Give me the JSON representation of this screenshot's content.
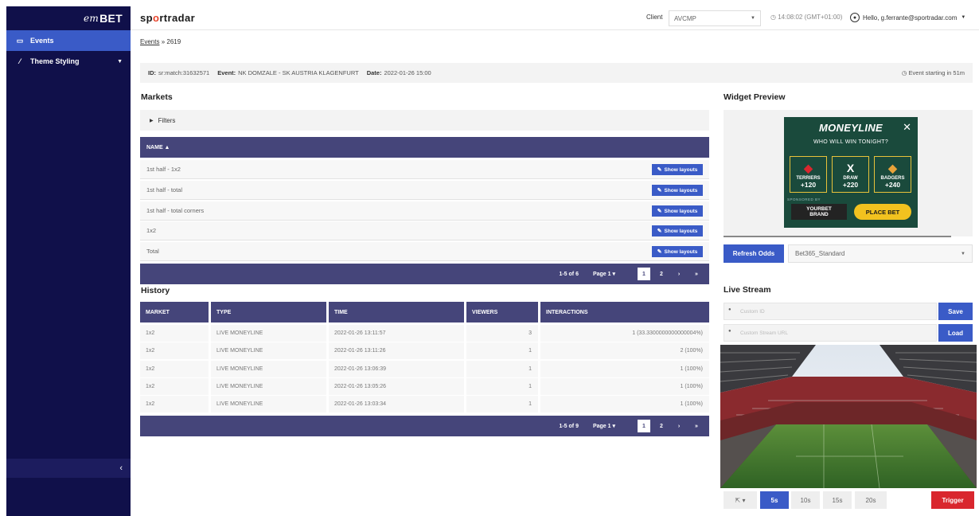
{
  "sidebar": {
    "brand_prefix": "em",
    "brand_suffix": "BET",
    "items": [
      {
        "label": "Events"
      },
      {
        "label": "Theme Styling"
      }
    ],
    "collapse_glyph": "‹"
  },
  "topbar": {
    "logo_pre": "sp",
    "logo_o": "o",
    "logo_post": "rtradar",
    "client_label": "Client",
    "client_value": "AVCMP",
    "time": "14:08:02 (GMT+01:00)",
    "greeting": "Hello, g.ferrante@sportradar.com"
  },
  "breadcrumb": {
    "link": "Events",
    "separator": "»",
    "current": "2619"
  },
  "event": {
    "id_label": "ID:",
    "id_value": "sr:match:31632571",
    "event_label": "Event:",
    "event_value": "NK DOMZALE - SK AUSTRIA KLAGENFURT",
    "date_label": "Date:",
    "date_value": "2022-01-26 15:00",
    "starting": "Event starting in 51m"
  },
  "markets": {
    "title": "Markets",
    "filters_label": "Filters",
    "column_name": "NAME ▲",
    "button_label": "Show layouts",
    "rows": [
      {
        "name": "1st half - 1x2"
      },
      {
        "name": "1st half - total"
      },
      {
        "name": "1st half - total corners"
      },
      {
        "name": "1x2"
      },
      {
        "name": "Total"
      }
    ],
    "pager": {
      "count": "1-5 of 6",
      "page": "Page 1 ▾",
      "pages": [
        "1",
        "2"
      ],
      "next": "›",
      "last": "»"
    }
  },
  "history": {
    "title": "History",
    "columns": [
      "MARKET",
      "TYPE",
      "TIME",
      "VIEWERS",
      "INTERACTIONS"
    ],
    "rows": [
      {
        "market": "1x2",
        "type": "LIVE MONEYLINE",
        "time": "2022-01-26 13:11:57",
        "viewers": "3",
        "interactions": "1 (33.3300000000000004%)"
      },
      {
        "market": "1x2",
        "type": "LIVE MONEYLINE",
        "time": "2022-01-26 13:11:26",
        "viewers": "1",
        "interactions": "2 (100%)"
      },
      {
        "market": "1x2",
        "type": "LIVE MONEYLINE",
        "time": "2022-01-26 13:06:39",
        "viewers": "1",
        "interactions": "1 (100%)"
      },
      {
        "market": "1x2",
        "type": "LIVE MONEYLINE",
        "time": "2022-01-26 13:05:26",
        "viewers": "1",
        "interactions": "1 (100%)"
      },
      {
        "market": "1x2",
        "type": "LIVE MONEYLINE",
        "time": "2022-01-26 13:03:34",
        "viewers": "1",
        "interactions": "1 (100%)"
      }
    ],
    "pager": {
      "count": "1-5 of 9",
      "page": "Page 1 ▾",
      "pages": [
        "1",
        "2"
      ],
      "next": "›",
      "last": "»"
    }
  },
  "widget_preview": {
    "title": "Widget Preview",
    "widget": {
      "title": "MONEYLINE",
      "close": "✕",
      "subtitle": "WHO WILL WIN TONIGHT?",
      "options": [
        {
          "name": "TERRIERS",
          "odds": "+120",
          "icon": "terrier-shield-icon",
          "glyph": "◆",
          "color": "#d9272e"
        },
        {
          "name": "DRAW",
          "odds": "+220",
          "icon": "draw-x-icon",
          "glyph": "X",
          "color": "#ffffff"
        },
        {
          "name": "BADGERS",
          "odds": "+240",
          "icon": "badger-shield-icon",
          "glyph": "◆",
          "color": "#e8a33a"
        }
      ],
      "sponsored": "SPONSORED BY",
      "brand_line1": "YOURBET",
      "brand_line2": "BRAND",
      "place_bet": "PLACE BET"
    },
    "refresh_label": "Refresh Odds",
    "odds_provider": "Bet365_Standard"
  },
  "live_stream": {
    "title": "Live Stream",
    "id_placeholder": "Custom ID",
    "url_placeholder": "Custom Stream URL",
    "save_label": "Save",
    "load_label": "Load",
    "controls": {
      "position": "⇱ ▾",
      "intervals": [
        "5s",
        "10s",
        "15s",
        "20s"
      ],
      "trigger": "Trigger"
    }
  },
  "colors": {
    "sidebar": "#10104a",
    "accent": "#3a5bc7",
    "table_header": "#45457a",
    "widget_bg": "#1a4a3c",
    "widget_gold": "#e8c23a",
    "trigger": "#d9272e"
  }
}
